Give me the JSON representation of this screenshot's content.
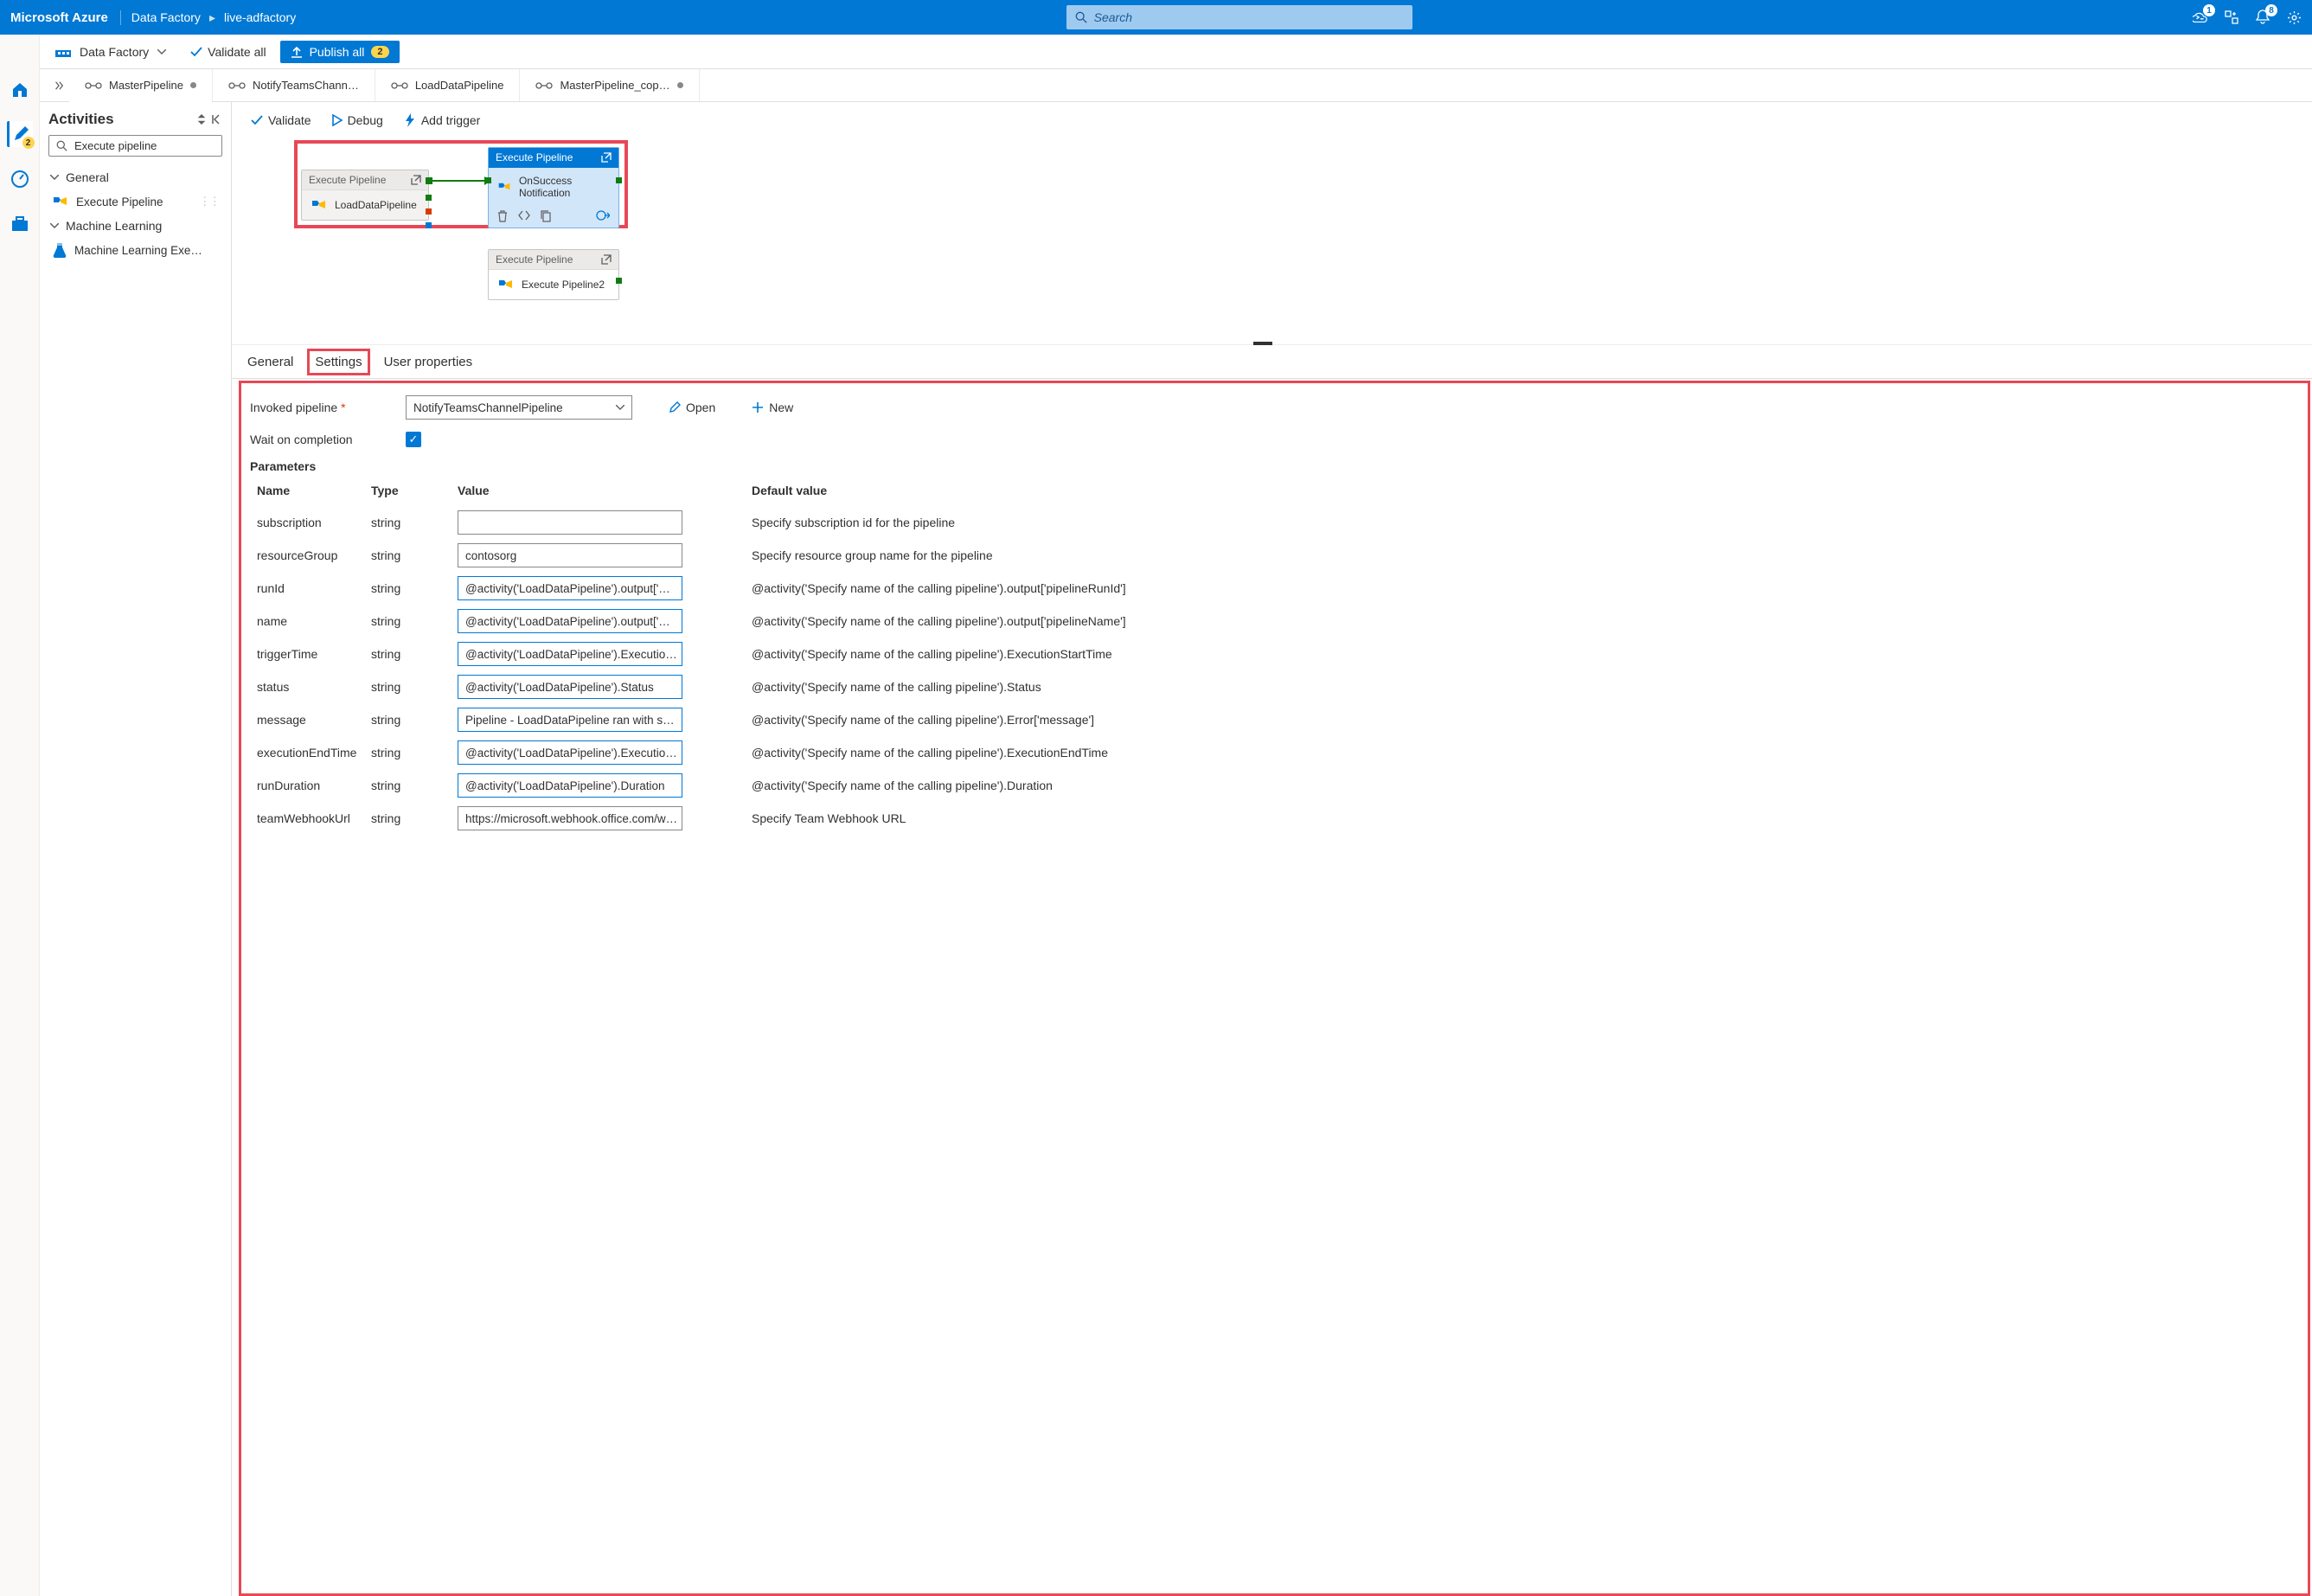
{
  "header": {
    "brand": "Microsoft Azure",
    "crumb1": "Data Factory",
    "crumb2": "live-adfactory",
    "search_placeholder": "Search",
    "badge_shell": "1",
    "badge_bell": "8"
  },
  "toolbar": {
    "menu_label": "Data Factory",
    "validate_all": "Validate all",
    "publish_all": "Publish all",
    "publish_count": "2"
  },
  "leftrail": {
    "pencil_badge": "2"
  },
  "tabs": [
    {
      "label": "MasterPipeline",
      "dirty": true
    },
    {
      "label": "NotifyTeamsChann…",
      "dirty": false
    },
    {
      "label": "LoadDataPipeline",
      "dirty": false
    },
    {
      "label": "MasterPipeline_cop…",
      "dirty": true
    }
  ],
  "explorer": {
    "title": "Activities",
    "search_value": "Execute pipeline",
    "group_general": "General",
    "item_exec": "Execute Pipeline",
    "group_ml": "Machine Learning",
    "item_ml": "Machine Learning Exe…"
  },
  "canvas_toolbar": {
    "validate": "Validate",
    "debug": "Debug",
    "add_trigger": "Add trigger"
  },
  "nodes": {
    "n1_type": "Execute Pipeline",
    "n1_name": "LoadDataPipeline",
    "n2_type": "Execute Pipeline",
    "n2_name": "OnSuccess Notification",
    "n3_type": "Execute Pipeline",
    "n3_name": "Execute Pipeline2"
  },
  "proptabs": {
    "general": "General",
    "settings": "Settings",
    "user_props": "User properties"
  },
  "settings": {
    "invoked_label": "Invoked pipeline",
    "invoked_value": "NotifyTeamsChannelPipeline",
    "open": "Open",
    "new": "New",
    "wait_label": "Wait on completion",
    "params_label": "Parameters",
    "columns": {
      "name": "Name",
      "type": "Type",
      "value": "Value",
      "default": "Default value"
    },
    "rows": [
      {
        "name": "subscription",
        "type": "string",
        "value": "",
        "default": "Specify subscription id for the pipeline"
      },
      {
        "name": "resourceGroup",
        "type": "string",
        "value": "contosorg",
        "default": "Specify resource group name for the pipeline"
      },
      {
        "name": "runId",
        "type": "string",
        "value": "@activity('LoadDataPipeline').output['…",
        "default": "@activity('Specify name of the calling pipeline').output['pipelineRunId']"
      },
      {
        "name": "name",
        "type": "string",
        "value": "@activity('LoadDataPipeline').output['…",
        "default": "@activity('Specify name of the calling pipeline').output['pipelineName']"
      },
      {
        "name": "triggerTime",
        "type": "string",
        "value": "@activity('LoadDataPipeline').Executio…",
        "default": "@activity('Specify name of the calling pipeline').ExecutionStartTime"
      },
      {
        "name": "status",
        "type": "string",
        "value": "@activity('LoadDataPipeline').Status",
        "default": "@activity('Specify name of the calling pipeline').Status"
      },
      {
        "name": "message",
        "type": "string",
        "value": "Pipeline - LoadDataPipeline ran with s…",
        "default": "@activity('Specify name of the calling pipeline').Error['message']"
      },
      {
        "name": "executionEndTime",
        "type": "string",
        "value": "@activity('LoadDataPipeline').Executio…",
        "default": "@activity('Specify name of the calling pipeline').ExecutionEndTime"
      },
      {
        "name": "runDuration",
        "type": "string",
        "value": "@activity('LoadDataPipeline').Duration",
        "default": "@activity('Specify name of the calling pipeline').Duration"
      },
      {
        "name": "teamWebhookUrl",
        "type": "string",
        "value": "https://microsoft.webhook.office.com/w…",
        "default": "Specify Team Webhook URL"
      }
    ]
  }
}
